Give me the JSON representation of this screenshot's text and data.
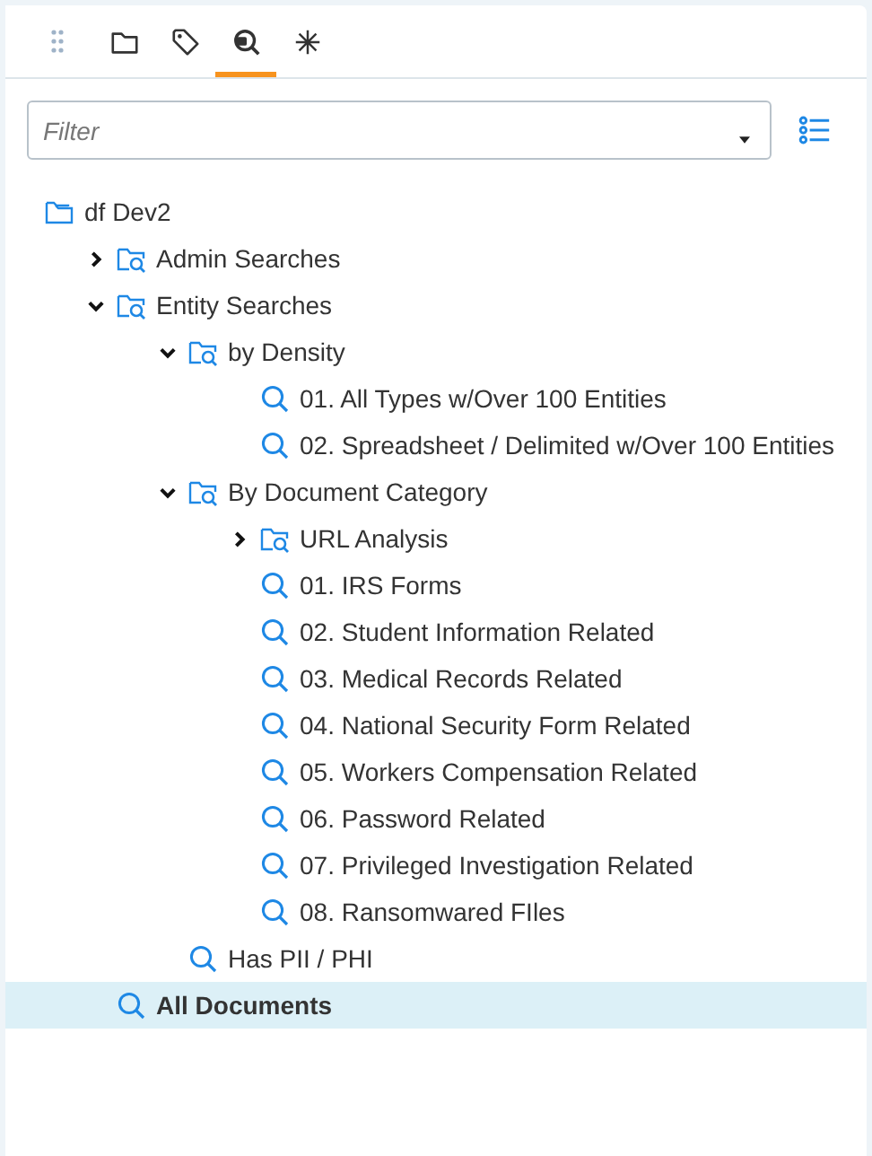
{
  "tabs": [
    {
      "kind": "folder",
      "selected": false
    },
    {
      "kind": "tag",
      "selected": false
    },
    {
      "kind": "search",
      "selected": true
    },
    {
      "kind": "asterisk",
      "selected": false
    }
  ],
  "filter": {
    "placeholder": "Filter"
  },
  "tree": [
    {
      "kind": "root",
      "label": "df Dev2",
      "selected": false,
      "children": [
        {
          "kind": "folder",
          "label": "Admin Searches",
          "expanded": false,
          "selected": false
        },
        {
          "kind": "folder",
          "label": "Entity Searches",
          "expanded": true,
          "selected": false,
          "children": [
            {
              "kind": "folder",
              "label": "by Density",
              "expanded": true,
              "selected": false,
              "children": [
                {
                  "kind": "search",
                  "label": "01. All Types w/Over 100 Entities",
                  "selected": false
                },
                {
                  "kind": "search",
                  "label": "02. Spreadsheet / Delimited w/Over 100 Entities",
                  "selected": false
                }
              ]
            },
            {
              "kind": "folder",
              "label": "By Document Category",
              "expanded": true,
              "selected": false,
              "children": [
                {
                  "kind": "folder",
                  "label": "URL Analysis",
                  "expanded": false,
                  "selected": false
                },
                {
                  "kind": "search",
                  "label": "01. IRS Forms",
                  "selected": false
                },
                {
                  "kind": "search",
                  "label": "02. Student Information Related",
                  "selected": false
                },
                {
                  "kind": "search",
                  "label": "03. Medical Records Related",
                  "selected": false
                },
                {
                  "kind": "search",
                  "label": "04. National Security Form Related",
                  "selected": false
                },
                {
                  "kind": "search",
                  "label": "05. Workers Compensation Related",
                  "selected": false
                },
                {
                  "kind": "search",
                  "label": "06. Password Related",
                  "selected": false
                },
                {
                  "kind": "search",
                  "label": "07. Privileged Investigation Related",
                  "selected": false
                },
                {
                  "kind": "search",
                  "label": "08. Ransomwared FIles",
                  "selected": false
                }
              ]
            },
            {
              "kind": "search",
              "label": "Has PII / PHI",
              "selected": false
            }
          ]
        },
        {
          "kind": "search",
          "label": "All Documents",
          "selected": true
        }
      ]
    }
  ]
}
